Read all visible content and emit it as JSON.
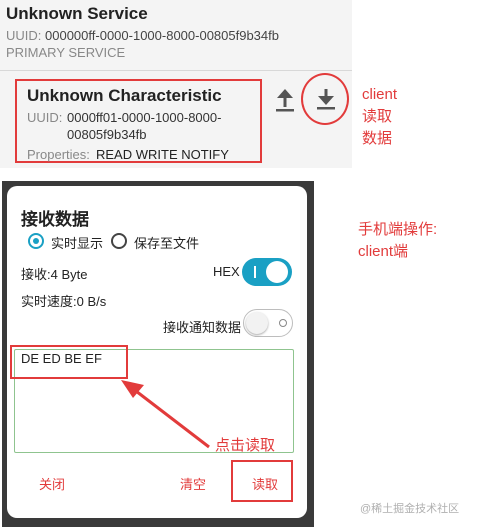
{
  "service": {
    "title": "Unknown Service",
    "uuid_label": "UUID:",
    "uuid": "000000ff-0000-1000-8000-00805f9b34fb",
    "type": "PRIMARY SERVICE"
  },
  "characteristic": {
    "title": "Unknown Characteristic",
    "uuid_label": "UUID:",
    "uuid_line1": "0000ff01-0000-1000-8000-",
    "uuid_line2": "00805f9b34fb",
    "properties_label": "Properties:",
    "properties": "READ WRITE NOTIFY",
    "upload_icon": "upload-icon",
    "download_icon": "download-icon"
  },
  "annotations": {
    "client_read_lines": [
      "client",
      "读取",
      "数据"
    ],
    "phone_op_lines": [
      "手机端操作:",
      "client端"
    ],
    "click_read": "点击读取"
  },
  "dialog": {
    "title": "接收数据",
    "radio_realtime": "实时显示",
    "radio_realtime_selected": true,
    "radio_savefile": "保存至文件",
    "recv_count": "接收:4 Byte",
    "hex_label": "HEX",
    "hex_enabled": true,
    "speed": "实时速度:0 B/s",
    "notify_label": "接收通知数据",
    "notify_enabled": false,
    "data_text": "DE ED BE EF",
    "buttons": {
      "close": "关闭",
      "clear": "清空",
      "read": "读取"
    }
  },
  "colors": {
    "accent": "#1aa0c4",
    "annotation_red": "#e23b3b"
  },
  "watermark": "@稀土掘金技术社区"
}
